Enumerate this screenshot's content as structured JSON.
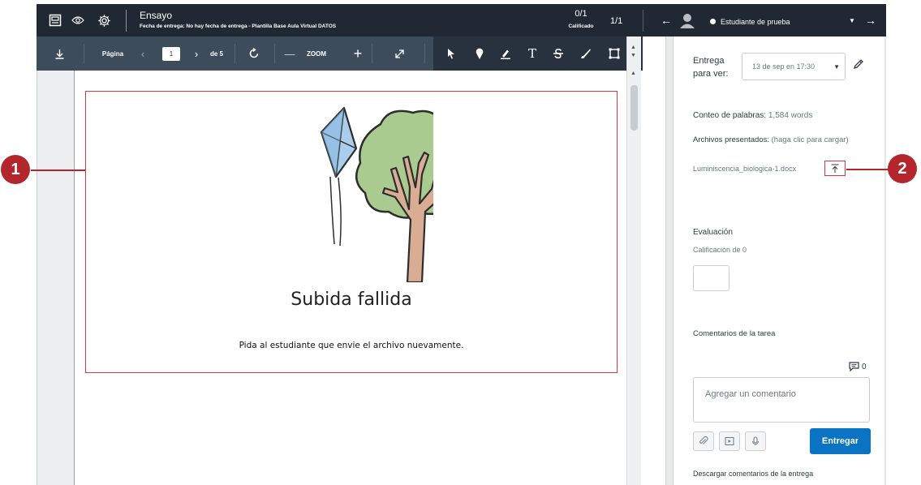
{
  "header": {
    "assignment_title": "Ensayo",
    "assignment_subtitle": "Fecha de entrega: No hay fecha de entrega - Plantilla Base Aula Virtual DATOS",
    "score_value": "0/1",
    "score_label": "Calificado",
    "student_count": "1/1",
    "student_name": "Estudiante de prueba",
    "icons": [
      "speedgrader-icon",
      "eye-icon",
      "gear-icon",
      "arrow-left-icon",
      "avatar-icon",
      "chevron-down-icon",
      "arrow-right-icon"
    ]
  },
  "pdf_toolbar": {
    "page_label": "Página",
    "page_value": "1",
    "page_total": "de 5",
    "zoom_label": "ZOOM",
    "icons": [
      "download-icon",
      "chevron-left-icon",
      "chevron-right-icon",
      "rotate-icon",
      "zoom-out-icon",
      "zoom-in-icon",
      "expand-icon",
      "pointer-icon",
      "pin-icon",
      "highlight-icon",
      "text-icon",
      "strikethrough-icon",
      "draw-icon",
      "area-icon"
    ]
  },
  "document": {
    "fail_title": "Subida fallida",
    "fail_message": "Pida al estudiante que envie el archivo nuevamente."
  },
  "sidebar": {
    "submission_label": "Entrega\npara ver:",
    "submission_selected": "13 de sep en 17:30",
    "word_count_label": "Conteo de palabras:",
    "word_count_value": "1,584 words",
    "files_label": "Archivos presentados:",
    "files_hint": "(haga clic para cargar)",
    "file_name": "Luminiscencia_biologica-1.docx",
    "evaluation_label": "Evaluación",
    "grade_label": "Calificación de 0",
    "grade_value": "",
    "comments_label": "Comentarios de la tarea",
    "comment_count": "0",
    "comment_placeholder": "Agregar un comentario",
    "submit_label": "Entregar",
    "download_comments": "Descargar comentarios de la entrega"
  },
  "callouts": [
    "1",
    "2"
  ],
  "colors": {
    "header_bg": "#1f2833",
    "toolbar_bg": "#3c4c5b",
    "accent_blue": "#0b73c3",
    "callout_red": "#b3262b",
    "highlight_red": "#d8383a"
  }
}
